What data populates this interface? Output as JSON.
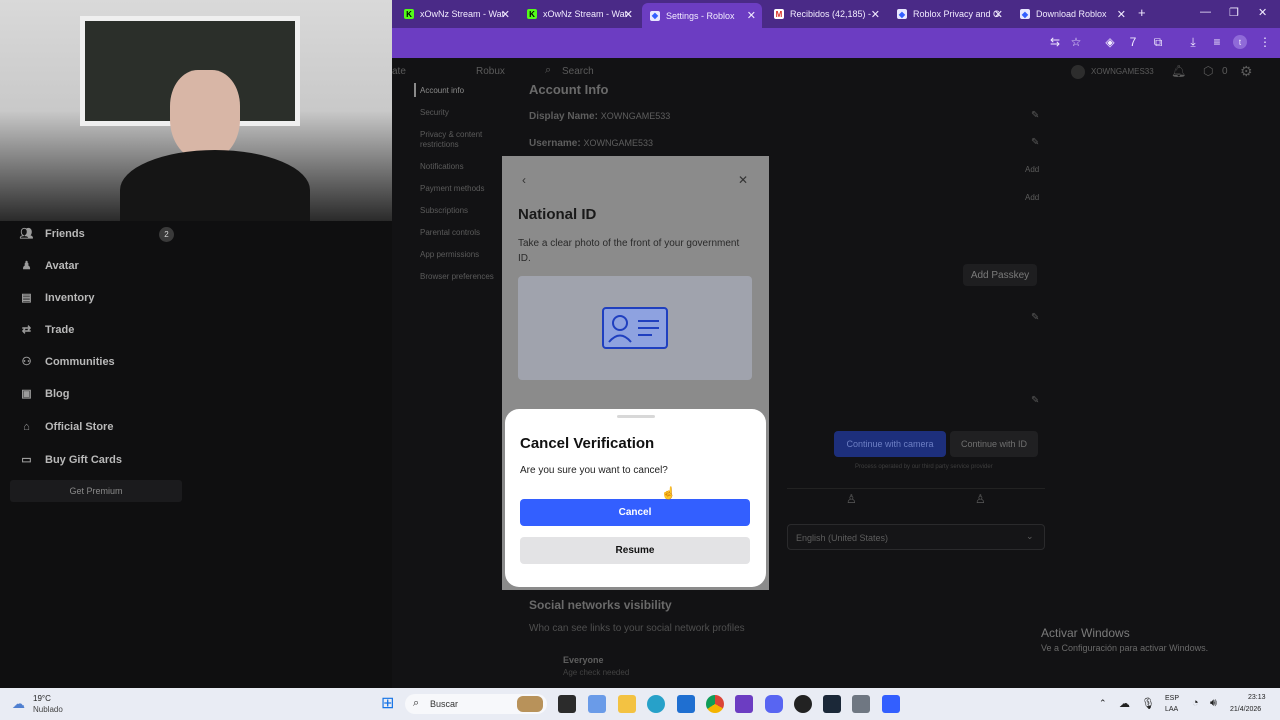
{
  "browser": {
    "tabs": [
      {
        "label": "xOwNz Stream - Wat",
        "icon": "kick-icon"
      },
      {
        "label": "xOwNz Stream - Wat",
        "icon": "kick-icon"
      },
      {
        "label": "Settings - Roblox",
        "icon": "roblox-icon",
        "active": true
      },
      {
        "label": "Recibidos (42,185) - ",
        "icon": "gmail-icon"
      },
      {
        "label": "Roblox Privacy and C",
        "icon": "roblox-icon"
      },
      {
        "label": "Download Roblox",
        "icon": "roblox-icon"
      }
    ],
    "new_tab": "+",
    "accent_color": "#6c3dc2"
  },
  "header": {
    "left_partial": "ate",
    "brand": "Robux",
    "search_placeholder": "Search",
    "username": "XOWNGAMES33",
    "robux_count": "0"
  },
  "left_nav": {
    "items": [
      {
        "label": "Friends",
        "icon": "people-icon",
        "badge": "2"
      },
      {
        "label": "Avatar",
        "icon": "avatar-icon"
      },
      {
        "label": "Inventory",
        "icon": "inventory-icon"
      },
      {
        "label": "Trade",
        "icon": "trade-icon"
      },
      {
        "label": "Communities",
        "icon": "communities-icon"
      },
      {
        "label": "Blog",
        "icon": "blog-icon"
      },
      {
        "label": "Official Store",
        "icon": "store-icon"
      },
      {
        "label": "Buy Gift Cards",
        "icon": "giftcard-icon"
      }
    ],
    "premium": "Get Premium"
  },
  "settings_nav": [
    "Account info",
    "Security",
    "Privacy & content restrictions",
    "Notifications",
    "Payment methods",
    "Subscriptions",
    "Parental controls",
    "App permissions",
    "Browser preferences"
  ],
  "account_info": {
    "heading": "Account Info",
    "display_name_label": "Display Name:",
    "display_name_value": "XOWNGAME533",
    "username_label": "Username:",
    "username_value": "XOWNGAME533",
    "add_1": "Add",
    "add_2": "Add",
    "add_passkey": "Add Passkey",
    "continue_camera": "Continue with camera",
    "continue_id": "Continue with ID",
    "powered": "Process operated by our third party service provider",
    "language": "English (United States)",
    "social_heading": "Social networks visibility",
    "social_desc": "Who can see links to your social network profiles",
    "everyone": "Everyone",
    "age_check": "Age check needed"
  },
  "sheet": {
    "title": "National ID",
    "description": "Take a clear photo of the front of your government ID."
  },
  "dialog": {
    "title": "Cancel Verification",
    "question": "Are you sure you want to cancel?",
    "cancel": "Cancel",
    "resume": "Resume"
  },
  "watermark": {
    "line1": "Activar Windows",
    "line2": "Ve a Configuración para activar Windows."
  },
  "taskbar": {
    "weather_temp": "19°C",
    "weather_desc": "Nublado",
    "search": "Buscar",
    "lang1": "ESP",
    "lang2": "LAA",
    "time": "23:13",
    "date": "21/4/2026"
  }
}
